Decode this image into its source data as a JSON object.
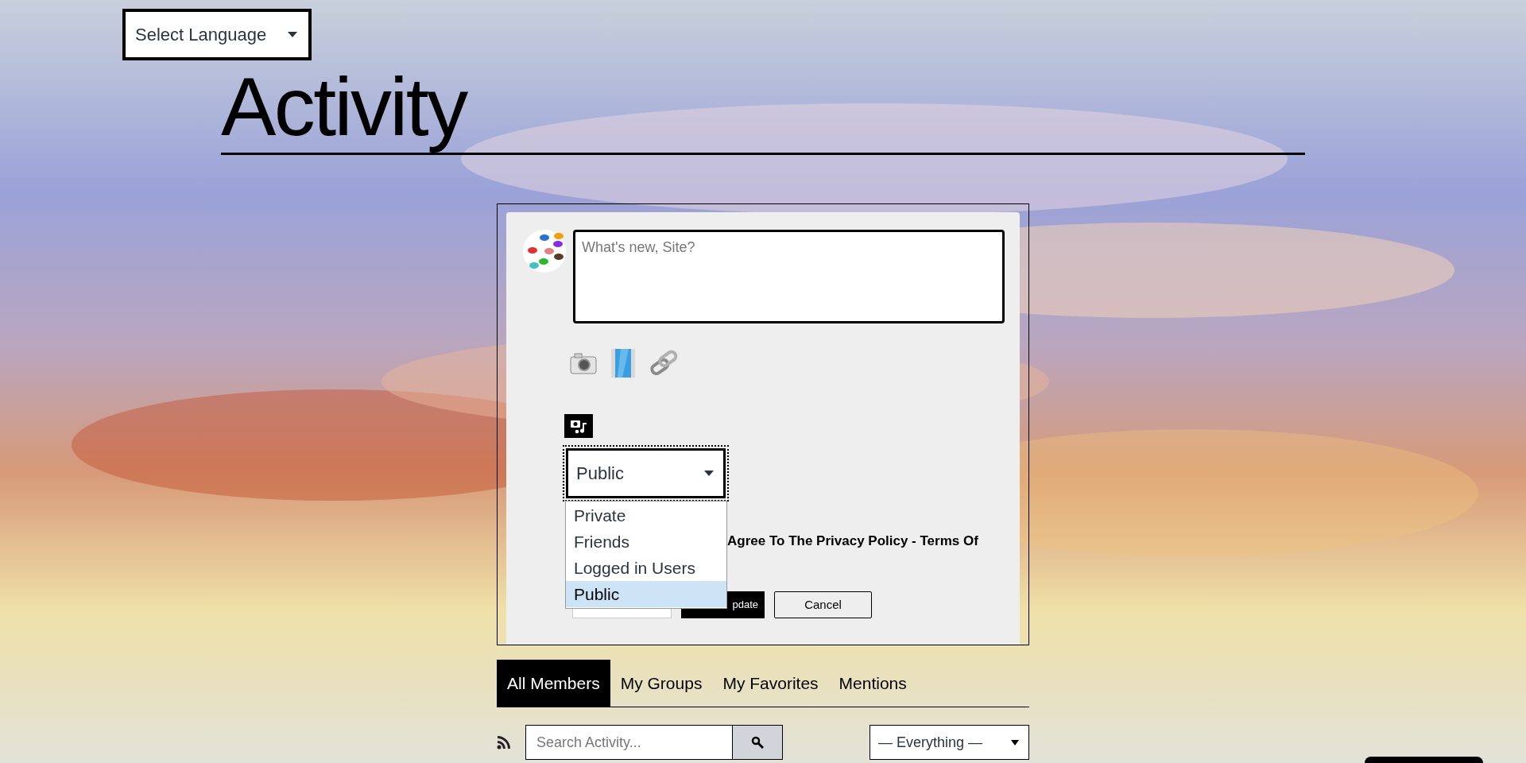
{
  "language_select": {
    "value": "Select Language"
  },
  "page_title": "Activity",
  "composer": {
    "placeholder": "What's new, Site?",
    "privacy_select": {
      "value": "Public",
      "expanded": true,
      "options": [
        {
          "label": "Private",
          "selected": false
        },
        {
          "label": "Friends",
          "selected": false
        },
        {
          "label": "Logged in Users",
          "selected": false
        },
        {
          "label": "Public",
          "selected": true
        }
      ]
    },
    "agreement_text": "Agree To The Privacy Policy - Terms Of",
    "post_button": {
      "label": "pdate"
    },
    "cancel_button": {
      "label": "Cancel"
    }
  },
  "tabs": [
    {
      "label": "All Members",
      "selected": true
    },
    {
      "label": "My Groups",
      "selected": false
    },
    {
      "label": "My Favorites",
      "selected": false
    },
    {
      "label": "Mentions",
      "selected": false
    }
  ],
  "search": {
    "placeholder": "Search Activity..."
  },
  "filter_select": {
    "value": "— Everything —"
  }
}
